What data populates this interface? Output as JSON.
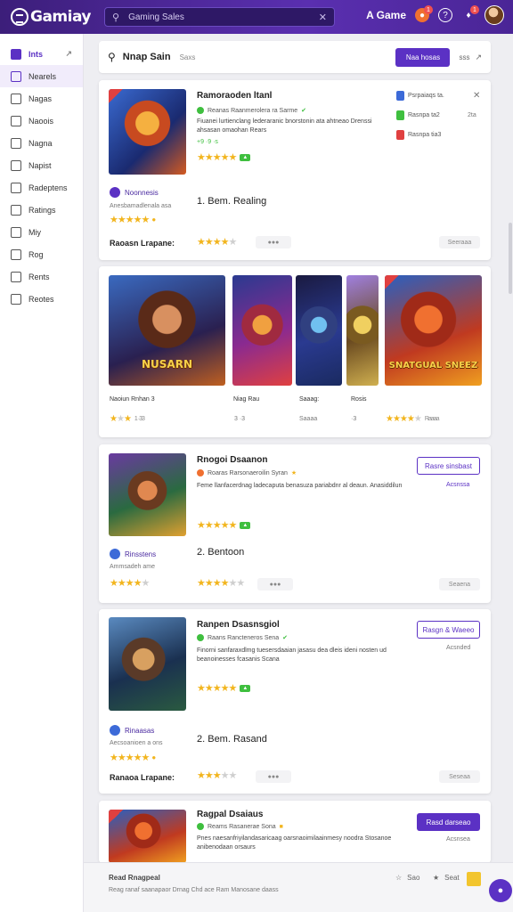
{
  "app": {
    "name": "Gamiay"
  },
  "header": {
    "search_value": "Gaming Sales",
    "account_label": "A Game",
    "notif_count": "1"
  },
  "sidebar": {
    "items": [
      {
        "label": "Ints",
        "icon": "home-icon"
      },
      {
        "label": "Nearels",
        "icon": "grid-icon"
      },
      {
        "label": "Nagas",
        "icon": "tag-icon"
      },
      {
        "label": "Naoois",
        "icon": "list-icon"
      },
      {
        "label": "Nagna",
        "icon": "box-icon"
      },
      {
        "label": "Napist",
        "icon": "doc-icon"
      },
      {
        "label": "Radeptens",
        "icon": "calendar-icon"
      },
      {
        "label": "Ratings",
        "icon": "chart-icon"
      },
      {
        "label": "Miy",
        "icon": "bookmark-icon"
      },
      {
        "label": "Rog",
        "icon": "log-icon"
      },
      {
        "label": "Rents",
        "icon": "rent-icon"
      },
      {
        "label": "Reotes",
        "icon": "note-icon"
      }
    ]
  },
  "toolbar": {
    "title": "Nnap Sain",
    "subtitle": "Saxs",
    "primary_button": "Naa hosas",
    "more_label": "sss"
  },
  "cards": [
    {
      "title": "Ramoraoden ltanl",
      "meta": "Reanas  Raanmerolera ra Sarme",
      "desc": "Fiuanei lurtienclang lederaranic bnorstonin ata ahtneao Drenssi ahsasan omaohan Rears",
      "score": "+9 ·9 ·s",
      "developer": "Noonnesis",
      "dev_sub": "Anesbamadlenala asa",
      "rank": "1. Bem. Realing",
      "label": "Raoasn Lrapane:",
      "chip": "Seeraaa",
      "platforms": [
        {
          "name": "Psrpaiaqs ta.",
          "color": "#3c6ad8"
        },
        {
          "name": "Rasnpa ta2",
          "color": "#3fbf3f"
        },
        {
          "name": "Rasnpa tia3",
          "color": "#e04040"
        }
      ],
      "plat_right": "2ta"
    },
    {
      "title": "Rnogoi Dsaanon",
      "meta": "Roaras  Rarsonaeroilin Syran",
      "desc": "Feme llanfacerdnag ladecaputa benasuza pariabdnr al deaun. Anasiddilun",
      "score": "",
      "developer": "Rinsstens",
      "dev_sub": "Ammsadeh ame",
      "rank": "2. Bentoon",
      "label": "",
      "chip": "Seaena",
      "button": "Rasre sinsbast",
      "button_sub": "Acsnssa"
    },
    {
      "title": "Ranpen Dsasnsgiol",
      "meta": "Raans  Rancteneros Sena",
      "desc": "Finorni sanfaraxdlmg tuesersdaaian jasasu dea dleis ideni nosten ud beanoinesses fcasanis Scana",
      "score": "",
      "developer": "Rinaasas",
      "dev_sub": "Aecsoanioen a ons",
      "rank": "2. Bem. Rasand",
      "label": "Ranaoa Lrapane:",
      "chip": "Seseaa",
      "button": "Rasgn & Waeeo",
      "button_sub": "Acsnded"
    },
    {
      "title": "Ragpal Dsaiaus",
      "meta": "Reams  Rasanerae Sona",
      "desc": "Pnes naesanfriyilandasaricaag oarsnaoimilaainmesy noodra Stosanoe anibenodaan orsaurs",
      "button": "Rasd darseao",
      "button_sub": "Acsnsea"
    }
  ],
  "gallery": {
    "items": [
      {
        "caption": "Naoiun Rnhan 3",
        "art_label": "NUSARN",
        "score": "1 ·33"
      },
      {
        "caption": "Niag Rau",
        "art_label": "",
        "score": "3 ·3"
      },
      {
        "caption": "Saaag:",
        "art_label": "",
        "score": "Saaaa"
      },
      {
        "caption": "Rosis",
        "art_label": "",
        "score": "·3"
      },
      {
        "caption": "",
        "art_label": "SNATGUAL SNEEZ",
        "score": "Raaaa"
      }
    ]
  },
  "footer": {
    "title": "Read Rnagpeal",
    "text": "Reag ranaf saanapaor  Drnag Chd  ace  Ram Manosane daass",
    "link1": "Sao",
    "link2": "Seat"
  }
}
